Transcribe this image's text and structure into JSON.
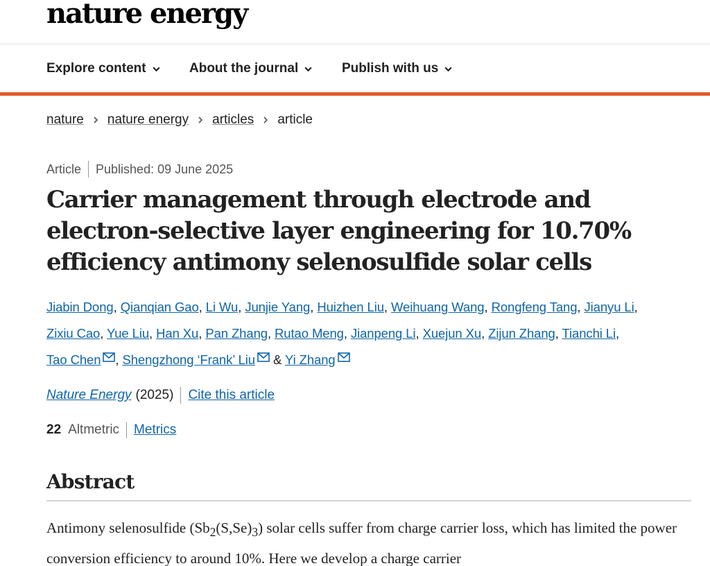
{
  "site": {
    "logo": "nature energy"
  },
  "nav": {
    "items": [
      {
        "label": "Explore content"
      },
      {
        "label": "About the journal"
      },
      {
        "label": "Publish with us"
      }
    ]
  },
  "breadcrumb": {
    "items": [
      "nature",
      "nature energy",
      "articles"
    ],
    "current": "article"
  },
  "article": {
    "type": "Article",
    "published": "Published: 09 June 2025",
    "title": "Carrier management through electrode and electron-selective layer engineering for 10.70% efficiency antimony selenosulfide solar cells",
    "authors": [
      {
        "name": "Jiabin Dong"
      },
      {
        "name": "Qianqian Gao"
      },
      {
        "name": "Li Wu"
      },
      {
        "name": "Junjie Yang"
      },
      {
        "name": "Huizhen Liu"
      },
      {
        "name": "Weihuang Wang"
      },
      {
        "name": "Rongfeng Tang"
      },
      {
        "name": "Jianyu Li"
      },
      {
        "name": "Zixiu Cao"
      },
      {
        "name": "Yue Liu"
      },
      {
        "name": "Han Xu"
      },
      {
        "name": "Pan Zhang"
      },
      {
        "name": "Rutao Meng"
      },
      {
        "name": "Jianpeng Li"
      },
      {
        "name": "Xuejun Xu"
      },
      {
        "name": "Zijun Zhang"
      },
      {
        "name": "Tianchi Li"
      },
      {
        "name": "Tao Chen"
      },
      {
        "name": "Shengzhong ‘Frank’ Liu"
      },
      {
        "name": "Yi Zhang"
      }
    ],
    "authors_joiner": "&",
    "journal": "Nature Energy",
    "year": "(2025)",
    "cite_label": "Cite this article",
    "altmetric_score": "22",
    "altmetric_label": "Altmetric",
    "metrics_label": "Metrics"
  },
  "abstract": {
    "heading": "Abstract",
    "text_part1": "Antimony selenosulfide (Sb",
    "sub1": "2",
    "text_part2": "(S,Se)",
    "sub2": "3",
    "text_part3": ") solar cells suffer from charge carrier loss, which has limited the power conversion efficiency to around 10%. Here we develop a charge carrier"
  },
  "colors": {
    "accent": "#e05a2b",
    "link": "#0f65a8",
    "text": "#222222"
  },
  "icons": {
    "nav_dropdown": "chevron-down-icon",
    "breadcrumb_sep": "chevron-right-icon",
    "author_email": "envelope-icon"
  }
}
